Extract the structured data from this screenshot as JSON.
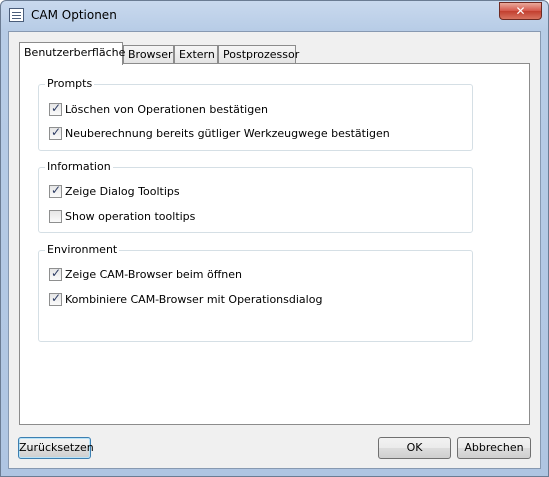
{
  "window": {
    "title": "CAM Optionen",
    "close_glyph": "✕"
  },
  "tabs": [
    "Benutzerberfläche",
    "Browser",
    "Extern",
    "Postprozessor"
  ],
  "groups": {
    "prompts": {
      "label": "Prompts",
      "items": [
        {
          "label": "Löschen von Operationen bestätigen",
          "checked": true
        },
        {
          "label": "Neuberechnung bereits gütliger Werkzeugwege bestätigen",
          "checked": true
        }
      ]
    },
    "information": {
      "label": "Information",
      "items": [
        {
          "label": "Zeige Dialog Tooltips",
          "checked": true
        },
        {
          "label": "Show operation tooltips",
          "checked": false
        }
      ]
    },
    "environment": {
      "label": "Environment",
      "items": [
        {
          "label": "Zeige CAM-Browser beim öffnen",
          "checked": true
        },
        {
          "label": "Kombiniere CAM-Browser mit Operationsdialog",
          "checked": true
        }
      ]
    }
  },
  "buttons": {
    "reset": "Zurücksetzen",
    "ok": "OK",
    "cancel": "Abbrechen"
  }
}
